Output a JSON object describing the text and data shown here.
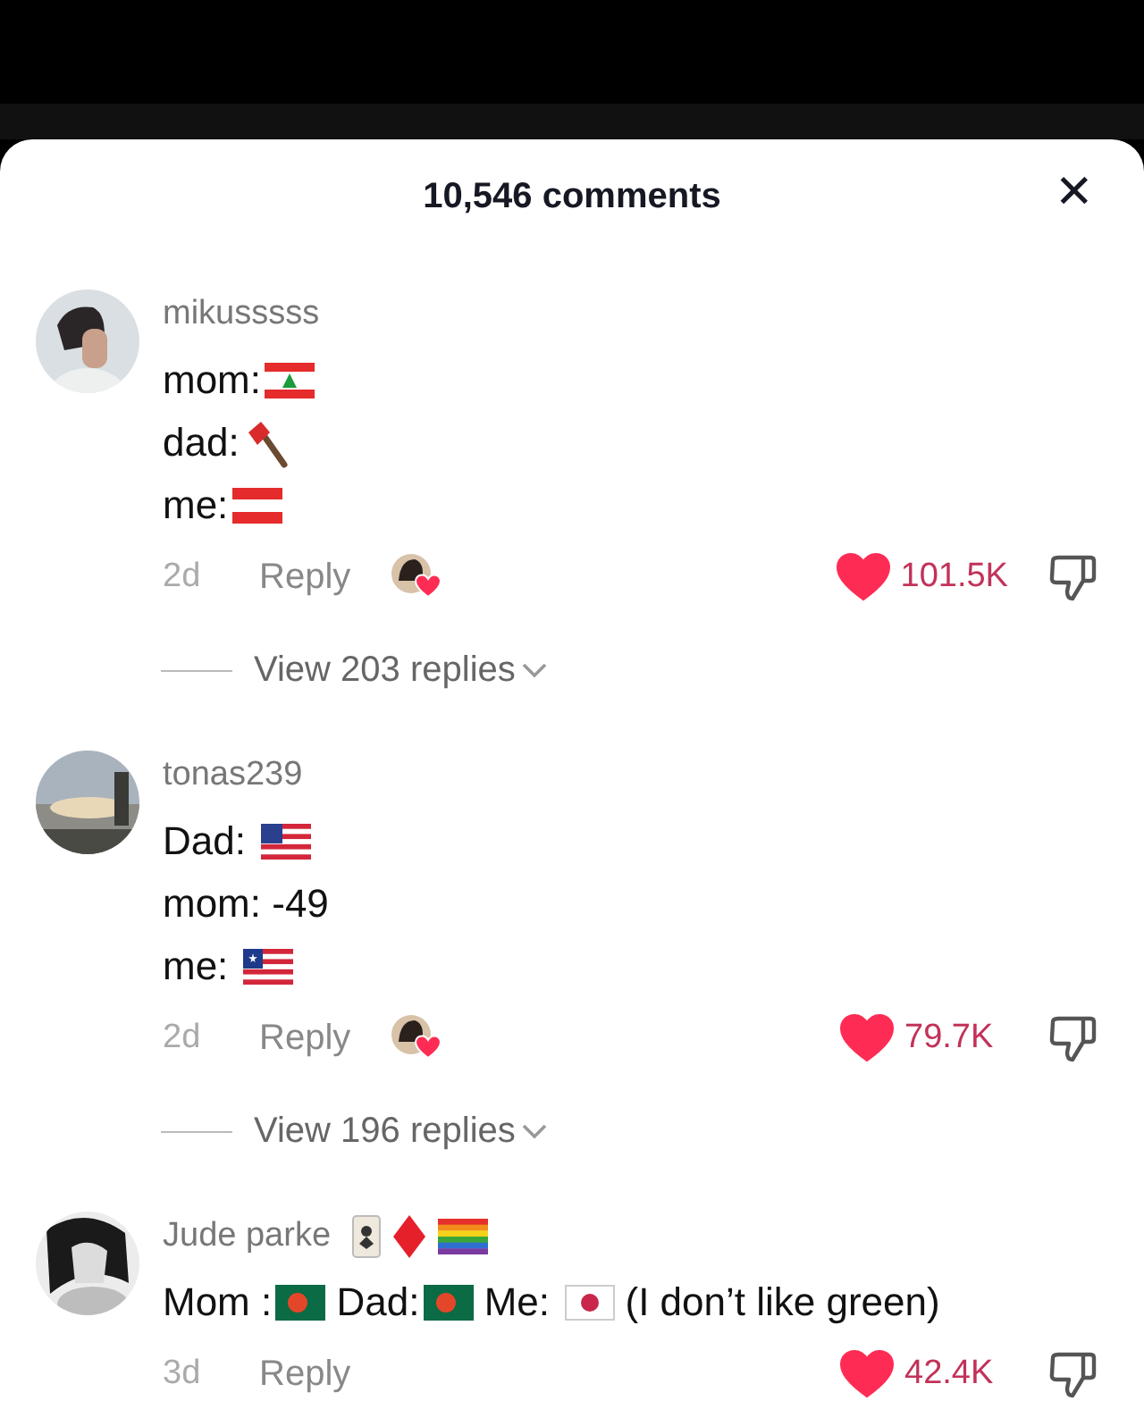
{
  "header": {
    "title": "10,546 comments",
    "close": "✕"
  },
  "comments": [
    {
      "username": "mikusssss",
      "lines": [
        [
          {
            "kind": "text",
            "text": "mom:"
          },
          {
            "kind": "lebanon"
          }
        ],
        [
          {
            "kind": "text",
            "text": "dad:"
          },
          {
            "kind": "axe"
          }
        ],
        [
          {
            "kind": "text",
            "text": "me:"
          },
          {
            "kind": "austria"
          }
        ]
      ],
      "age": "2d",
      "reply": "Reply",
      "creator_liked": true,
      "liked": true,
      "likes": "101.5K",
      "replies": "View 203 replies"
    },
    {
      "username": "tonas239",
      "lines": [
        [
          {
            "kind": "text",
            "text": "Dad: "
          },
          {
            "kind": "usa"
          }
        ],
        [
          {
            "kind": "text",
            "text": "mom: -49"
          }
        ],
        [
          {
            "kind": "text",
            "text": "me: "
          },
          {
            "kind": "liberia"
          }
        ]
      ],
      "age": "2d",
      "reply": "Reply",
      "creator_liked": true,
      "liked": true,
      "likes": "79.7K",
      "replies": "View 196 replies"
    },
    {
      "username": "Jude parke",
      "badges": [
        {
          "kind": "card"
        },
        {
          "kind": "diamond"
        },
        {
          "kind": "rainbow"
        }
      ],
      "lines": [
        [
          {
            "kind": "text",
            "text": "Mom :"
          },
          {
            "kind": "bangladesh"
          },
          {
            "kind": "text",
            "text": " Dad:"
          },
          {
            "kind": "bangladesh"
          },
          {
            "kind": "text",
            "text": " Me: "
          },
          {
            "kind": "japan"
          },
          {
            "kind": "text",
            "text": " (I don’t like green)"
          }
        ]
      ],
      "age": "3d",
      "reply": "Reply",
      "creator_liked": false,
      "liked": true,
      "likes": "42.4K"
    }
  ]
}
